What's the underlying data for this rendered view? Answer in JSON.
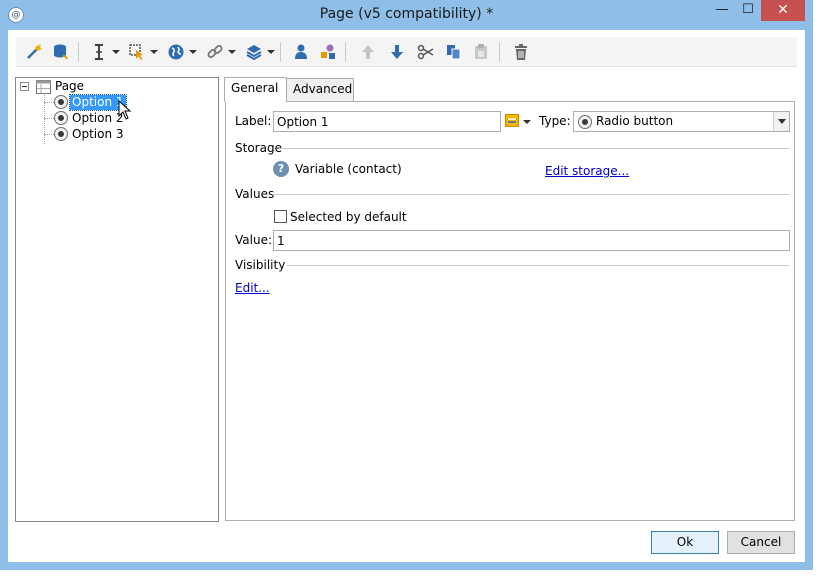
{
  "window": {
    "title": "Page (v5 compatibility) *",
    "min_glyph": "—",
    "max_glyph": "☐",
    "close_glyph": "✕",
    "app_icon_glyph": "@"
  },
  "toolbar": {
    "icons": [
      "wand-icon",
      "database-icon",
      "text-cursor-icon",
      "input-field-icon",
      "globe-icon",
      "link-icon",
      "layers-icon",
      "person-icon",
      "shapes-icon",
      "arrow-up-icon",
      "arrow-down-icon",
      "cut-icon",
      "copy-icon",
      "paste-icon",
      "delete-icon"
    ]
  },
  "tree": {
    "root": "Page",
    "items": [
      {
        "label": "Option 1",
        "selected": true
      },
      {
        "label": "Option 2",
        "selected": false
      },
      {
        "label": "Option 3",
        "selected": false
      }
    ]
  },
  "tabs": [
    {
      "label": "General",
      "active": true
    },
    {
      "label": "Advanced",
      "active": false
    }
  ],
  "general": {
    "label_caption": "Label:",
    "label_value": "Option 1",
    "type_caption": "Type:",
    "type_value": "Radio button",
    "storage_section": "Storage",
    "storage_value": "Variable (contact)",
    "edit_storage_link": "Edit storage...",
    "values_section": "Values",
    "selected_default_label": "Selected by default",
    "selected_default_checked": false,
    "value_caption": "Value:",
    "value_value": "1",
    "visibility_section": "Visibility",
    "visibility_edit_link": "Edit..."
  },
  "buttons": {
    "ok": "Ok",
    "cancel": "Cancel"
  },
  "colors": {
    "titlebar": "#8fbfe8",
    "close_button": "#c75050",
    "selection": "#3399ff",
    "link": "#0000cc"
  }
}
